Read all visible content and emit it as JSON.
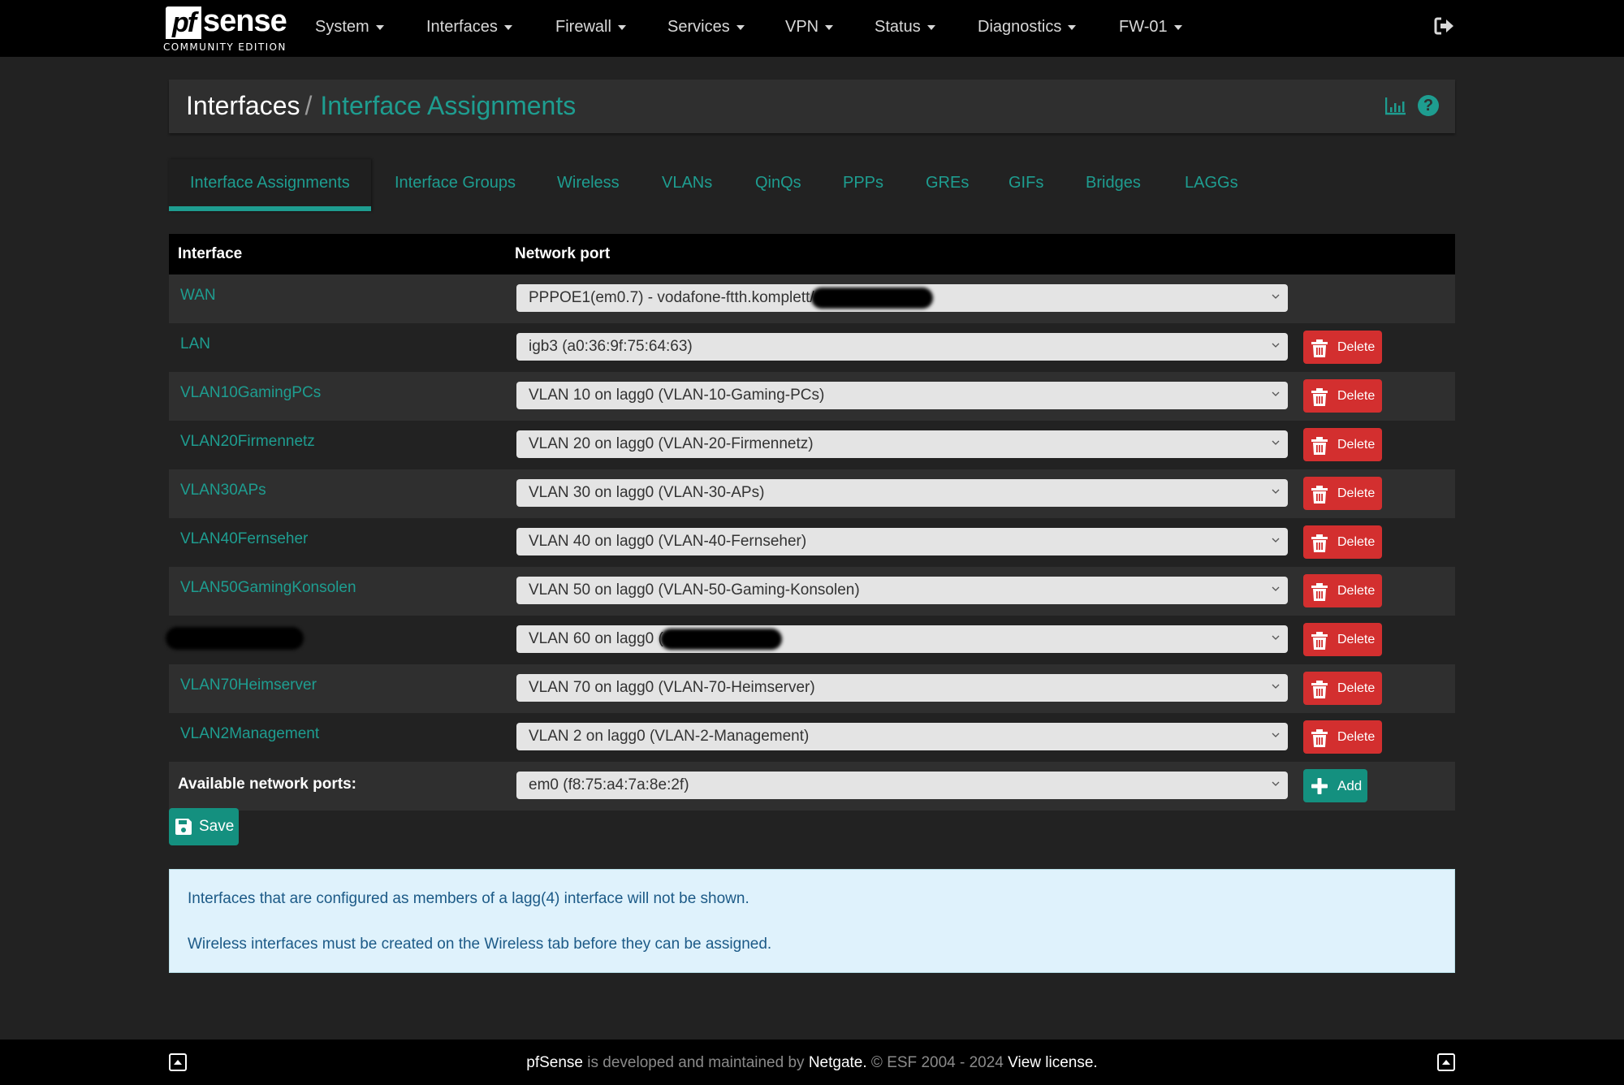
{
  "navbar": {
    "logo": {
      "pf": "pf",
      "sense": "sense",
      "edition": "COMMUNITY EDITION"
    },
    "menu": [
      {
        "label": "System"
      },
      {
        "label": "Interfaces"
      },
      {
        "label": "Firewall"
      },
      {
        "label": "Services"
      },
      {
        "label": "VPN"
      },
      {
        "label": "Status"
      },
      {
        "label": "Diagnostics"
      },
      {
        "label": "FW-01"
      }
    ],
    "logout_icon": "sign-out-icon"
  },
  "breadcrumb": {
    "parent": "Interfaces",
    "separator": "/",
    "current": "Interface Assignments",
    "icons": [
      "bar-chart-icon",
      "help-icon"
    ],
    "help_glyph": "?"
  },
  "tabs": [
    {
      "label": "Interface Assignments",
      "active": true
    },
    {
      "label": "Interface Groups"
    },
    {
      "label": "Wireless"
    },
    {
      "label": "VLANs"
    },
    {
      "label": "QinQs"
    },
    {
      "label": "PPPs"
    },
    {
      "label": "GREs"
    },
    {
      "label": "GIFs"
    },
    {
      "label": "Bridges"
    },
    {
      "label": "LAGGs"
    }
  ],
  "table": {
    "headers": {
      "interface": "Interface",
      "network_port": "Network port"
    },
    "rows": [
      {
        "interface": "WAN",
        "port": "PPPOE1(em0.7) - vodafone-ftth.komplett/",
        "redacted_port": true,
        "deletable": false
      },
      {
        "interface": "LAN",
        "port": "igb3 (a0:36:9f:75:64:63)",
        "deletable": true
      },
      {
        "interface": "VLAN10GamingPCs",
        "port": "VLAN 10 on lagg0 (VLAN-10-Gaming-PCs)",
        "deletable": true
      },
      {
        "interface": "VLAN20Firmennetz",
        "port": "VLAN 20 on lagg0 (VLAN-20-Firmennetz)",
        "deletable": true
      },
      {
        "interface": "VLAN30APs",
        "port": "VLAN 30 on lagg0 (VLAN-30-APs)",
        "deletable": true
      },
      {
        "interface": "VLAN40Fernseher",
        "port": "VLAN 40 on lagg0 (VLAN-40-Fernseher)",
        "deletable": true
      },
      {
        "interface": "VLAN50GamingKonsolen",
        "port": "VLAN 50 on lagg0 (VLAN-50-Gaming-Konsolen)",
        "deletable": true
      },
      {
        "interface": "",
        "redacted_interface": true,
        "port": "VLAN 60 on lagg0 (",
        "redacted_port": true,
        "deletable": true
      },
      {
        "interface": "VLAN70Heimserver",
        "port": "VLAN 70 on lagg0 (VLAN-70-Heimserver)",
        "deletable": true
      },
      {
        "interface": "VLAN2Management",
        "port": "VLAN 2 on lagg0 (VLAN-2-Management)",
        "deletable": true
      }
    ],
    "delete_label": "Delete",
    "available": {
      "label": "Available network ports:",
      "port": "em0 (f8:75:a4:7a:8e:2f)",
      "add_label": "Add"
    }
  },
  "save_label": "Save",
  "info": {
    "lines": [
      "Interfaces that are configured as members of a lagg(4) interface will not be shown.",
      "Wireless interfaces must be created on the Wireless tab before they can be assigned."
    ]
  },
  "footer": {
    "brand": "pfSense",
    "text1": " is developed and maintained by ",
    "company": "Netgate.",
    "text2": " © ESF 2004 - 2024 ",
    "license": "View license."
  },
  "colors": {
    "accent": "#1e9d90",
    "danger": "#d32f2f",
    "success": "#14907f",
    "navbar": "#000000",
    "background": "#222222",
    "info_bg": "#dff2fc",
    "info_text": "#1c5a87"
  }
}
